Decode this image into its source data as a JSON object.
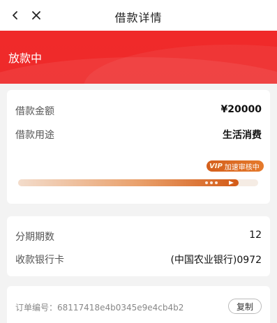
{
  "header": {
    "title": "借款详情",
    "back_icon": "chevron-left-icon",
    "close_icon": "close-icon"
  },
  "status": {
    "text": "放款中",
    "color": "#ee2a2a"
  },
  "loan": {
    "amount_label": "借款金额",
    "amount_value": "¥20000",
    "purpose_label": "借款用途",
    "purpose_value": "生活消费",
    "vip_badge": "VIP",
    "vip_text": "加速审核中",
    "progress_fraction": 0.92
  },
  "installment": {
    "periods_label": "分期期数",
    "periods_value": "12",
    "bank_label": "收款银行卡",
    "bank_value": "(中国农业银行)0972"
  },
  "order": {
    "label": "订单编号：68117418e4b0345e9e4cb4b2",
    "copy_label": "复制"
  }
}
